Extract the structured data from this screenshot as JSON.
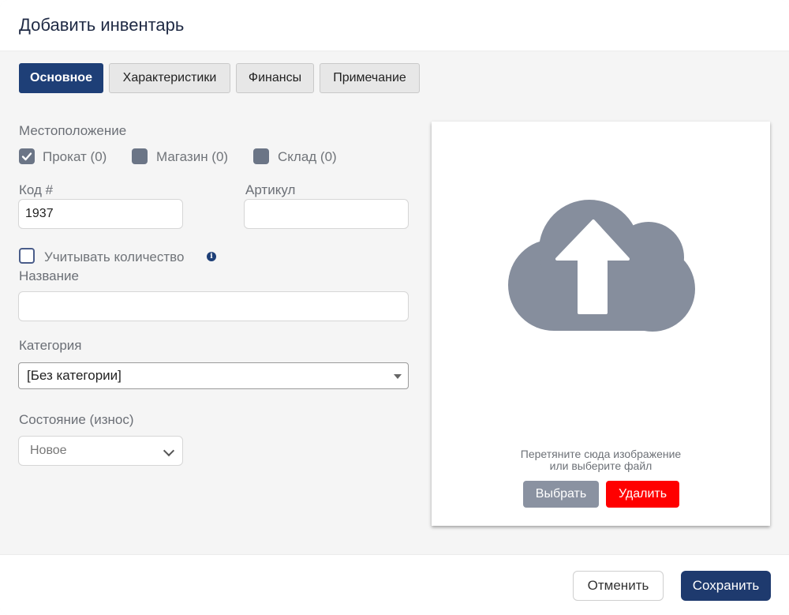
{
  "dialog": {
    "title": "Добавить инвентарь"
  },
  "tabs": [
    {
      "label": "Основное",
      "active": true
    },
    {
      "label": "Характеристики",
      "active": false
    },
    {
      "label": "Финансы",
      "active": false
    },
    {
      "label": "Примечание",
      "active": false
    }
  ],
  "location": {
    "label": "Местоположение",
    "options": [
      {
        "label": "Прокат (0)",
        "checked": true
      },
      {
        "label": "Магазин (0)",
        "checked": false
      },
      {
        "label": "Склад (0)",
        "checked": false
      }
    ]
  },
  "code": {
    "label": "Код #",
    "value": "1937"
  },
  "article": {
    "label": "Артикул",
    "value": ""
  },
  "track_quantity": {
    "label": "Учитывать количество",
    "checked": false,
    "info_icon": "info-icon"
  },
  "name": {
    "label": "Название",
    "value": ""
  },
  "category": {
    "label": "Категория",
    "selected": "[Без категории]"
  },
  "condition": {
    "label": "Состояние (износ)",
    "selected": "Новое"
  },
  "upload": {
    "icon": "cloud-upload-icon",
    "hint_line1": "Перетяните сюда изображение",
    "hint_line2": "или выберите файл",
    "choose_label": "Выбрать",
    "delete_label": "Удалить"
  },
  "footer": {
    "cancel_label": "Отменить",
    "save_label": "Сохранить"
  },
  "colors": {
    "primary": "#1e3f77",
    "danger": "#ff0000",
    "muted": "#8a92a1"
  }
}
